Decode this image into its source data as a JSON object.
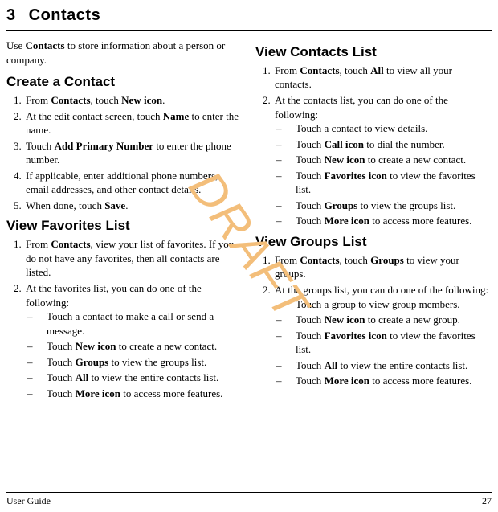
{
  "chapter": {
    "number": "3",
    "title": "Contacts"
  },
  "intro": {
    "pre": "Use ",
    "b1": "Contacts",
    "post": " to store information about a person or company."
  },
  "watermark": "DRAFT",
  "footer": {
    "left": "User Guide",
    "right": "27"
  },
  "left": {
    "s1": {
      "heading": "Create a Contact",
      "i1": {
        "a": "From ",
        "b1": "Contacts",
        "b": ", touch ",
        "b2": "New icon",
        "c": "."
      },
      "i2": {
        "a": "At the edit contact screen, touch ",
        "b1": "Name",
        "b": " to enter the name."
      },
      "i3": {
        "a": "Touch ",
        "b1": "Add Primary Number",
        "b": " to enter the phone number."
      },
      "i4": {
        "a": "If applicable, enter additional phone numbers, email addresses, and other contact details."
      },
      "i5": {
        "a": "When done, touch ",
        "b1": "Save",
        "b": "."
      }
    },
    "s2": {
      "heading": "View Favorites List",
      "i1": {
        "a": "From ",
        "b1": "Contacts",
        "b": ", view your list of favorites. If you do not have any favorites, then all contacts are listed."
      },
      "i2": {
        "a": "At the favorites list, you can do one of the following:"
      },
      "d1": {
        "a": "Touch a contact to make a call or send a message."
      },
      "d2": {
        "a": "Touch ",
        "b1": "New icon",
        "b": " to create a new contact."
      },
      "d3": {
        "a": "Touch ",
        "b1": "Groups",
        "b": " to view the groups list."
      },
      "d4": {
        "a": "Touch ",
        "b1": "All",
        "b": " to view the entire contacts list."
      },
      "d5": {
        "a": "Touch ",
        "b1": "More icon",
        "b": " to access more features."
      }
    }
  },
  "right": {
    "s1": {
      "heading": "View Contacts List",
      "i1": {
        "a": "From ",
        "b1": "Contacts",
        "b": ", touch ",
        "b2": "All",
        "c": " to view all your contacts."
      },
      "i2": {
        "a": "At the contacts list, you can do one of the following:"
      },
      "d1": {
        "a": "Touch a contact to view details."
      },
      "d2": {
        "a": "Touch ",
        "b1": "Call icon",
        "b": " to dial the number."
      },
      "d3": {
        "a": "Touch ",
        "b1": "New icon",
        "b": " to create a new contact."
      },
      "d4": {
        "a": "Touch ",
        "b1": "Favorites icon",
        "b": " to view the favorites list."
      },
      "d5": {
        "a": "Touch ",
        "b1": "Groups",
        "b": " to view the groups list."
      },
      "d6": {
        "a": "Touch ",
        "b1": "More icon",
        "b": " to access more features."
      }
    },
    "s2": {
      "heading": "View Groups List",
      "i1": {
        "a": "From ",
        "b1": "Contacts",
        "b": ", touch ",
        "b2": "Groups",
        "c": " to view your groups."
      },
      "i2": {
        "a": "At the groups list, you can do one of the following:"
      },
      "d1": {
        "a": "Touch a group to view group members."
      },
      "d2": {
        "a": "Touch ",
        "b1": "New icon",
        "b": " to create a new group."
      },
      "d3": {
        "a": "Touch ",
        "b1": "Favorites icon",
        "b": " to view the favorites list."
      },
      "d4": {
        "a": "Touch ",
        "b1": "All",
        "b": " to view the entire contacts list."
      },
      "d5": {
        "a": "Touch ",
        "b1": "More icon",
        "b": " to access more features."
      }
    }
  }
}
